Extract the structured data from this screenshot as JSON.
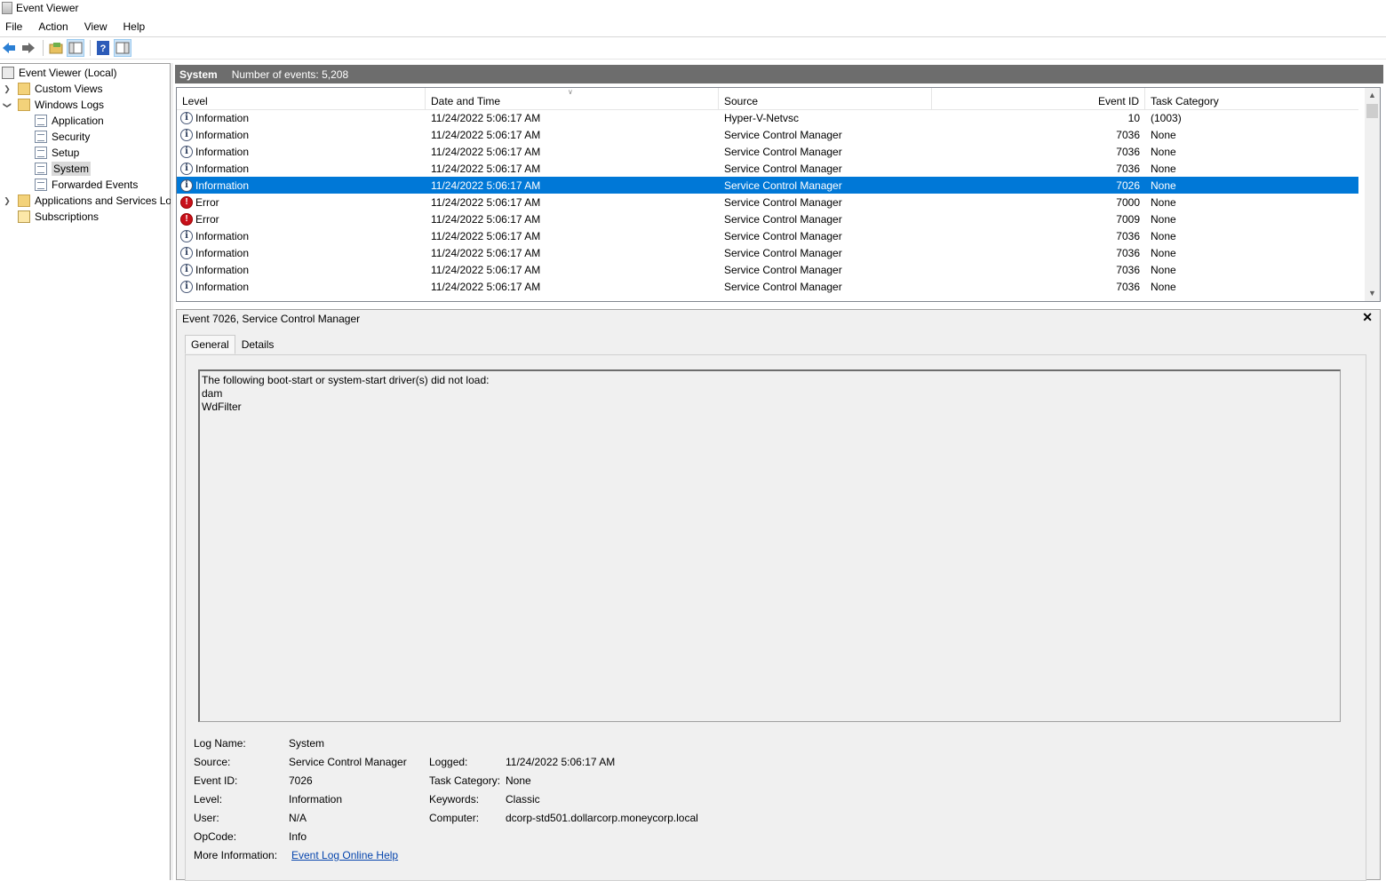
{
  "window": {
    "title": "Event Viewer"
  },
  "menu": [
    "File",
    "Action",
    "View",
    "Help"
  ],
  "toolbar": {
    "icons": [
      "back-arrow-icon",
      "forward-arrow-icon",
      "open-folder-icon",
      "show-hide-tree-icon",
      "help-icon",
      "show-action-pane-icon"
    ]
  },
  "tree": {
    "root": "Event Viewer (Local)",
    "custom_views": "Custom Views",
    "windows_logs": "Windows Logs",
    "application": "Application",
    "security": "Security",
    "setup": "Setup",
    "system": "System",
    "forwarded": "Forwarded Events",
    "apps_services": "Applications and Services Lo",
    "subscriptions": "Subscriptions"
  },
  "header": {
    "log_name": "System",
    "count": "Number of events: 5,208"
  },
  "columns": {
    "level": "Level",
    "date": "Date and Time",
    "source": "Source",
    "event_id": "Event ID",
    "task": "Task Category"
  },
  "events": [
    {
      "level": "Information",
      "type": "info",
      "date": "11/24/2022 5:06:17 AM",
      "source": "Hyper-V-Netvsc",
      "id": "10",
      "task": "(1003)"
    },
    {
      "level": "Information",
      "type": "info",
      "date": "11/24/2022 5:06:17 AM",
      "source": "Service Control Manager",
      "id": "7036",
      "task": "None"
    },
    {
      "level": "Information",
      "type": "info",
      "date": "11/24/2022 5:06:17 AM",
      "source": "Service Control Manager",
      "id": "7036",
      "task": "None"
    },
    {
      "level": "Information",
      "type": "info",
      "date": "11/24/2022 5:06:17 AM",
      "source": "Service Control Manager",
      "id": "7036",
      "task": "None"
    },
    {
      "level": "Information",
      "type": "info",
      "date": "11/24/2022 5:06:17 AM",
      "source": "Service Control Manager",
      "id": "7026",
      "task": "None",
      "selected": true
    },
    {
      "level": "Error",
      "type": "err",
      "date": "11/24/2022 5:06:17 AM",
      "source": "Service Control Manager",
      "id": "7000",
      "task": "None"
    },
    {
      "level": "Error",
      "type": "err",
      "date": "11/24/2022 5:06:17 AM",
      "source": "Service Control Manager",
      "id": "7009",
      "task": "None"
    },
    {
      "level": "Information",
      "type": "info",
      "date": "11/24/2022 5:06:17 AM",
      "source": "Service Control Manager",
      "id": "7036",
      "task": "None"
    },
    {
      "level": "Information",
      "type": "info",
      "date": "11/24/2022 5:06:17 AM",
      "source": "Service Control Manager",
      "id": "7036",
      "task": "None"
    },
    {
      "level": "Information",
      "type": "info",
      "date": "11/24/2022 5:06:17 AM",
      "source": "Service Control Manager",
      "id": "7036",
      "task": "None"
    },
    {
      "level": "Information",
      "type": "info",
      "date": "11/24/2022 5:06:17 AM",
      "source": "Service Control Manager",
      "id": "7036",
      "task": "None"
    }
  ],
  "detail": {
    "title": "Event 7026, Service Control Manager",
    "close": "✕",
    "tabs": {
      "general": "General",
      "details": "Details"
    },
    "message": [
      "The following boot-start or system-start driver(s) did not load:",
      "dam",
      "WdFilter"
    ],
    "labels": {
      "log_name": "Log Name:",
      "source": "Source:",
      "event_id": "Event ID:",
      "level": "Level:",
      "user": "User:",
      "opcode": "OpCode:",
      "more_info": "More Information:",
      "logged": "Logged:",
      "task_category": "Task Category:",
      "keywords": "Keywords:",
      "computer": "Computer:"
    },
    "values": {
      "log_name": "System",
      "source": "Service Control Manager",
      "event_id": "7026",
      "level": "Information",
      "user": "N/A",
      "opcode": "Info",
      "more_info": "Event Log Online Help",
      "logged": "11/24/2022 5:06:17 AM",
      "task_category": "None",
      "keywords": "Classic",
      "computer": "dcorp-std501.dollarcorp.moneycorp.local"
    }
  }
}
